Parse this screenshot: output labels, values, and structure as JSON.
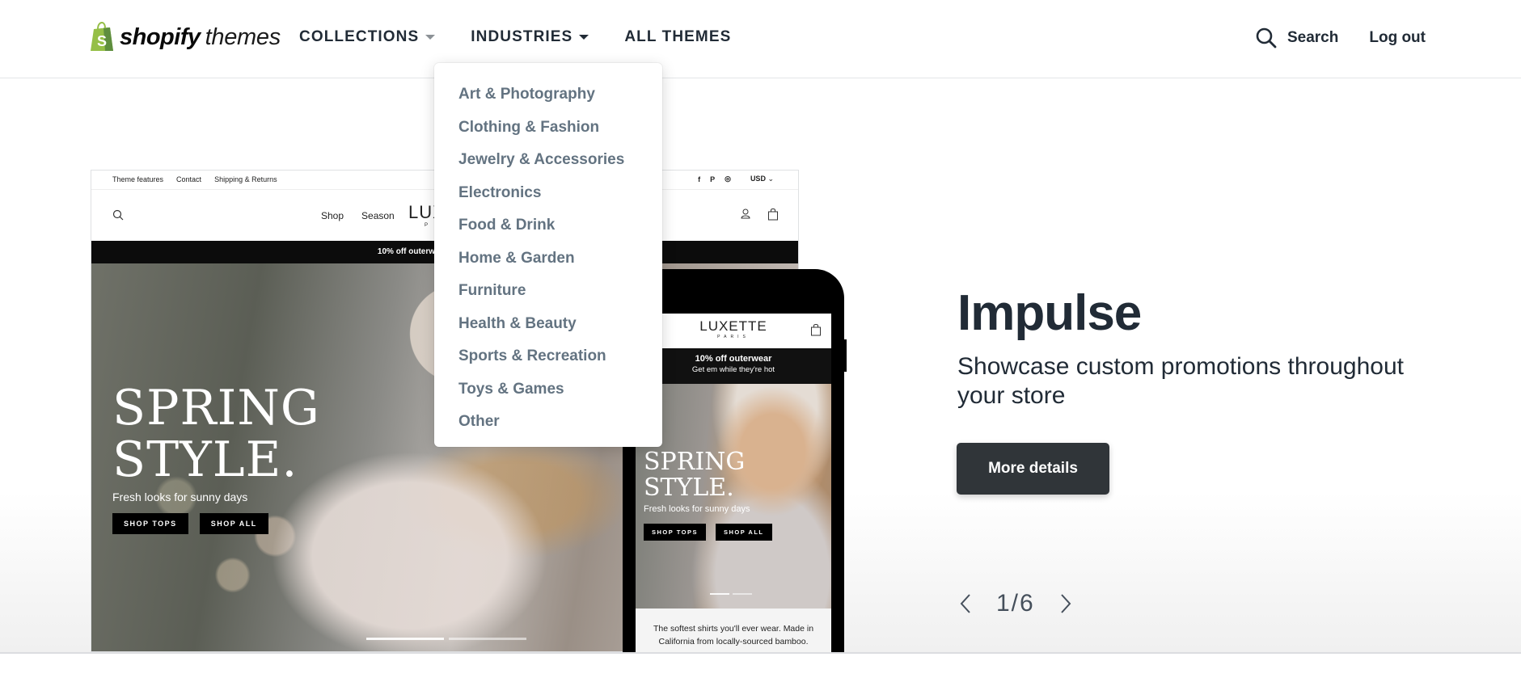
{
  "header": {
    "logo": {
      "bold": "shopify",
      "light": "themes",
      "bag_letter": "S",
      "brand_color": "#95bf47"
    },
    "nav": [
      {
        "label": "COLLECTIONS",
        "has_caret": true,
        "expanded": false
      },
      {
        "label": "INDUSTRIES",
        "has_caret": true,
        "expanded": true
      },
      {
        "label": "ALL THEMES",
        "has_caret": false
      }
    ],
    "search_label": "Search",
    "logout_label": "Log out"
  },
  "industries_menu": {
    "items": [
      {
        "label": "Art & Photography"
      },
      {
        "label": "Clothing & Fashion"
      },
      {
        "label": "Jewelry & Accessories"
      },
      {
        "label": "Electronics"
      },
      {
        "label": "Food & Drink"
      },
      {
        "label": "Home & Garden"
      },
      {
        "label": "Furniture"
      },
      {
        "label": "Health & Beauty"
      },
      {
        "label": "Sports & Recreation"
      },
      {
        "label": "Toys & Games"
      },
      {
        "label": "Other"
      }
    ]
  },
  "preview": {
    "desktop": {
      "top_links": [
        "Theme features",
        "Contact",
        "Shipping & Returns"
      ],
      "currency": "USD",
      "social": [
        "f",
        "P",
        "◎"
      ],
      "nav_links": [
        "Shop",
        "Season"
      ],
      "store_logo": "LUX",
      "store_logo_sub": "P",
      "promo": "10% off outerwear",
      "hero_title_1": "SPRING",
      "hero_title_2": "STYLE.",
      "hero_sub": "Fresh looks for sunny days",
      "btn_1": "SHOP TOPS",
      "btn_2": "SHOP ALL"
    },
    "mobile": {
      "store_logo": "LUXETTE",
      "store_logo_sub": "PARIS",
      "promo_title": "10% off outerwear",
      "promo_sub": "Get em while they're hot",
      "hero_title_1": "SPRING",
      "hero_title_2": "STYLE.",
      "hero_sub": "Fresh looks for sunny days",
      "btn_1": "SHOP TOPS",
      "btn_2": "SHOP ALL",
      "description": "The softest shirts you'll ever wear. Made in California from locally-sourced bamboo."
    }
  },
  "theme": {
    "name": "Impulse",
    "tagline": "Showcase custom promotions throughout your store",
    "cta_label": "More details"
  },
  "pager": {
    "current": 1,
    "total": 6,
    "label": "1/6"
  }
}
